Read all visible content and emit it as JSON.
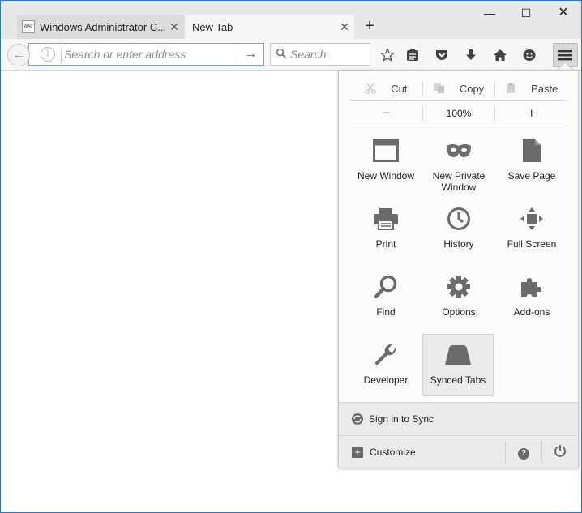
{
  "tabs": [
    {
      "favicon_text": "WAC",
      "title": "Windows Administrator C...",
      "close": "✕"
    },
    {
      "title": "New Tab",
      "close": "✕"
    }
  ],
  "new_tab_symbol": "+",
  "window_controls": {
    "minimize": "—",
    "maximize": "☐",
    "close": "✕"
  },
  "navbar": {
    "back_symbol": "←",
    "info_symbol": "i",
    "url_placeholder": "Search or enter address",
    "go_symbol": "→",
    "search_placeholder": "Search",
    "toolbar_icons": [
      "bookmark-star-icon",
      "reading-list-icon",
      "pocket-icon",
      "downloads-icon",
      "home-icon",
      "hello-icon",
      "menu-icon"
    ]
  },
  "menu_panel": {
    "edit": {
      "cut": "Cut",
      "copy": "Copy",
      "paste": "Paste"
    },
    "zoom": {
      "out": "−",
      "level": "100%",
      "in": "+"
    },
    "items": [
      {
        "label": "New Window",
        "icon": "new-window-icon"
      },
      {
        "label": "New Private Window",
        "icon": "private-mask-icon"
      },
      {
        "label": "Save Page",
        "icon": "save-page-icon"
      },
      {
        "label": "Print",
        "icon": "print-icon"
      },
      {
        "label": "History",
        "icon": "history-clock-icon"
      },
      {
        "label": "Full Screen",
        "icon": "fullscreen-icon"
      },
      {
        "label": "Find",
        "icon": "find-magnifier-icon"
      },
      {
        "label": "Options",
        "icon": "options-gear-icon"
      },
      {
        "label": "Add-ons",
        "icon": "addons-puzzle-icon"
      },
      {
        "label": "Developer",
        "icon": "developer-wrench-icon"
      },
      {
        "label": "Synced Tabs",
        "icon": "synced-tabs-icon",
        "selected": true
      }
    ],
    "sign_in": "Sign in to Sync",
    "customize": "Customize",
    "help_symbol": "?",
    "quit_symbol": "⏻"
  },
  "colors": {
    "accent_border": "#2b78c4",
    "icon_gray": "#6b6b6b",
    "url_focus": "#6aa9e6"
  }
}
